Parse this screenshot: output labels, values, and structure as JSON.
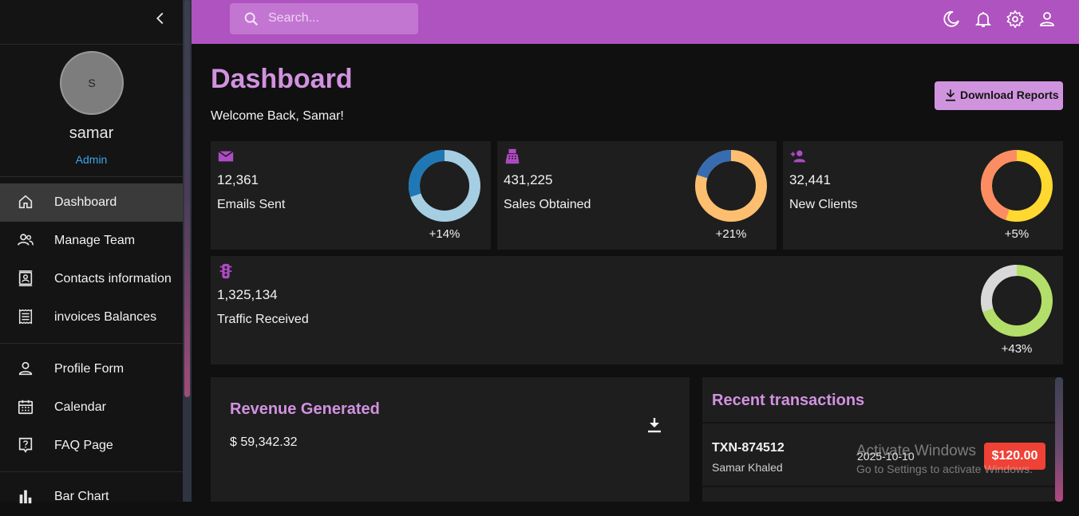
{
  "sidebar": {
    "avatar_initial": "S",
    "user_name": "samar",
    "user_role": "Admin",
    "items": [
      {
        "label": "Dashboard",
        "icon": "home-icon",
        "active": true
      },
      {
        "label": "Manage Team",
        "icon": "people-icon"
      },
      {
        "label": "Contacts information",
        "icon": "contacts-icon"
      },
      {
        "label": "invoices Balances",
        "icon": "receipt-icon"
      },
      {
        "label": "Profile Form",
        "icon": "person-icon"
      },
      {
        "label": "Calendar",
        "icon": "calendar-icon"
      },
      {
        "label": "FAQ Page",
        "icon": "help-icon"
      },
      {
        "label": "Bar Chart",
        "icon": "bar-chart-icon"
      }
    ]
  },
  "topbar": {
    "search_placeholder": "Search...",
    "icons": [
      "dark-mode-icon",
      "notifications-icon",
      "settings-icon",
      "account-icon"
    ],
    "accent": "#af53c0"
  },
  "header": {
    "title": "Dashboard",
    "subtitle": "Welcome Back, Samar!",
    "download_label": "Download Reports"
  },
  "stats": [
    {
      "value": "12,361",
      "label": "Emails Sent",
      "percent_text": "+14%",
      "ring_fill": 0.7,
      "icon": "email-icon",
      "ring_colors": [
        "#a6cee3",
        "#1f78b4"
      ]
    },
    {
      "value": "431,225",
      "label": "Sales Obtained",
      "percent_text": "+21%",
      "ring_fill": 0.8,
      "icon": "point-of-sale-icon",
      "ring_colors": [
        "#fdbf6f",
        "#386cb0"
      ]
    },
    {
      "value": "32,441",
      "label": "New Clients",
      "percent_text": "+5%",
      "ring_fill": 0.55,
      "icon": "person-add-icon",
      "ring_colors": [
        "#ffd92f",
        "#fc8d62"
      ]
    },
    {
      "value": "1,325,134",
      "label": "Traffic Received",
      "percent_text": "+43%",
      "ring_fill": 0.7,
      "icon": "traffic-icon",
      "ring_colors": [
        "#b3de69",
        "#d9d9d9"
      ]
    }
  ],
  "revenue": {
    "title": "Revenue Generated",
    "amount": "$ 59,342.32"
  },
  "transactions": {
    "title": "Recent transactions",
    "items": [
      {
        "id": "TXN-874512",
        "user": "Samar Khaled",
        "date": "2025-10-10",
        "amount": "$120.00"
      }
    ]
  },
  "watermark": {
    "line1": "Activate Windows",
    "line2": "Go to Settings to activate Windows."
  }
}
